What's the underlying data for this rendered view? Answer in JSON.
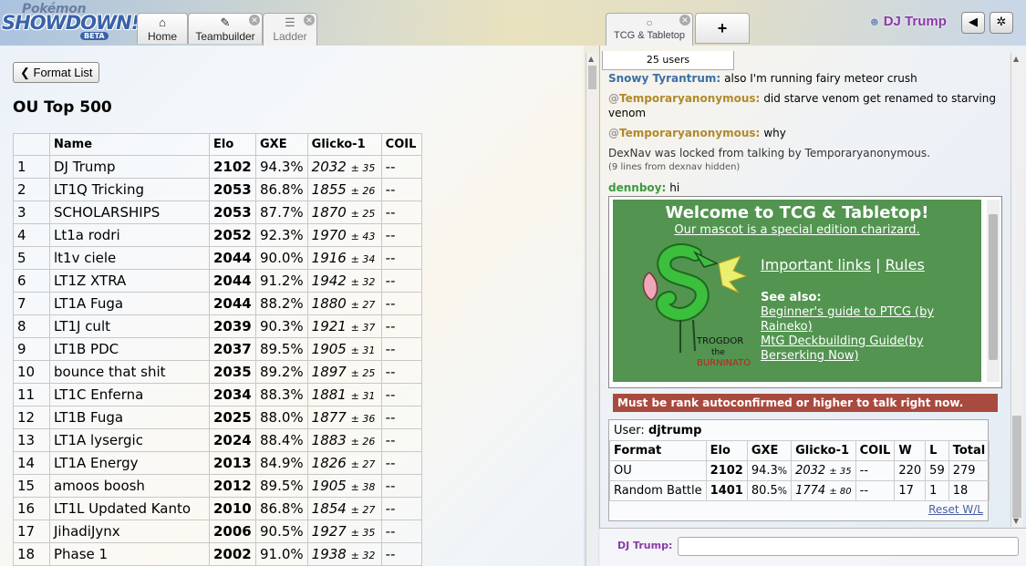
{
  "header": {
    "logo_top": "Pokémon",
    "logo_main": "SHOWDOWN!",
    "logo_beta": "BETA",
    "tabs": [
      {
        "icon": "⌂",
        "label": "Home"
      },
      {
        "icon": "✎",
        "label": "Teambuilder"
      },
      {
        "icon": "☰",
        "label": "Ladder"
      }
    ],
    "close_glyph": "✕",
    "room_tab": {
      "icon": "○",
      "label": "TCG & Tabletop"
    },
    "plus_label": "+",
    "username": "DJ Trump",
    "sound_icon": "◀",
    "settings_icon": "✲"
  },
  "ladder": {
    "back_label": "Format List",
    "title": "OU Top 500",
    "columns": [
      "",
      "Name",
      "Elo",
      "GXE",
      "Glicko-1",
      "COIL"
    ],
    "rows": [
      {
        "rank": "1",
        "name": "DJ Trump",
        "elo": "2102",
        "gxe": "94.3%",
        "glicko": "2032",
        "dev": "± 35",
        "coil": "--"
      },
      {
        "rank": "2",
        "name": "LT1Q Tricking",
        "elo": "2053",
        "gxe": "86.8%",
        "glicko": "1855",
        "dev": "± 26",
        "coil": "--"
      },
      {
        "rank": "3",
        "name": "SCHOLARSHIPS",
        "elo": "2053",
        "gxe": "87.7%",
        "glicko": "1870",
        "dev": "± 25",
        "coil": "--"
      },
      {
        "rank": "4",
        "name": "Lt1a rodri",
        "elo": "2052",
        "gxe": "92.3%",
        "glicko": "1970",
        "dev": "± 43",
        "coil": "--"
      },
      {
        "rank": "5",
        "name": "lt1v ciele",
        "elo": "2044",
        "gxe": "90.0%",
        "glicko": "1916",
        "dev": "± 34",
        "coil": "--"
      },
      {
        "rank": "6",
        "name": "LT1Z XTRA",
        "elo": "2044",
        "gxe": "91.2%",
        "glicko": "1942",
        "dev": "± 32",
        "coil": "--"
      },
      {
        "rank": "7",
        "name": "LT1A Fuga",
        "elo": "2044",
        "gxe": "88.2%",
        "glicko": "1880",
        "dev": "± 27",
        "coil": "--"
      },
      {
        "rank": "8",
        "name": "LT1J cult",
        "elo": "2039",
        "gxe": "90.3%",
        "glicko": "1921",
        "dev": "± 37",
        "coil": "--"
      },
      {
        "rank": "9",
        "name": "LT1B PDC",
        "elo": "2037",
        "gxe": "89.5%",
        "glicko": "1905",
        "dev": "± 31",
        "coil": "--"
      },
      {
        "rank": "10",
        "name": "bounce that shit",
        "elo": "2035",
        "gxe": "89.2%",
        "glicko": "1897",
        "dev": "± 25",
        "coil": "--"
      },
      {
        "rank": "11",
        "name": "LT1C Enferna",
        "elo": "2034",
        "gxe": "88.3%",
        "glicko": "1881",
        "dev": "± 31",
        "coil": "--"
      },
      {
        "rank": "12",
        "name": "LT1B Fuga",
        "elo": "2025",
        "gxe": "88.0%",
        "glicko": "1877",
        "dev": "± 36",
        "coil": "--"
      },
      {
        "rank": "13",
        "name": "LT1A lysergic",
        "elo": "2024",
        "gxe": "88.4%",
        "glicko": "1883",
        "dev": "± 26",
        "coil": "--"
      },
      {
        "rank": "14",
        "name": "LT1A Energy",
        "elo": "2013",
        "gxe": "84.9%",
        "glicko": "1826",
        "dev": "± 27",
        "coil": "--"
      },
      {
        "rank": "15",
        "name": "amoos boosh",
        "elo": "2012",
        "gxe": "89.5%",
        "glicko": "1905",
        "dev": "± 38",
        "coil": "--"
      },
      {
        "rank": "16",
        "name": "LT1L Updated Kanto",
        "elo": "2010",
        "gxe": "86.8%",
        "glicko": "1854",
        "dev": "± 27",
        "coil": "--"
      },
      {
        "rank": "17",
        "name": "JihadiJynx",
        "elo": "2006",
        "gxe": "90.5%",
        "glicko": "1927",
        "dev": "± 35",
        "coil": "--"
      },
      {
        "rank": "18",
        "name": "Phase 1",
        "elo": "2002",
        "gxe": "91.0%",
        "glicko": "1938",
        "dev": "± 32",
        "coil": "--"
      }
    ]
  },
  "chat": {
    "users_count": "25 users",
    "messages": [
      {
        "name": "Snowy Tyrantrum:",
        "prefix": "",
        "text": "also I'm running fairy meteor crush",
        "cls": "snowy"
      },
      {
        "name": "Temporaryanonymous:",
        "prefix": "@",
        "text": "did starve venom get renamed to starving venom",
        "cls": "temp"
      },
      {
        "name": "Temporaryanonymous:",
        "prefix": "@",
        "text": "why",
        "cls": "temp"
      }
    ],
    "system_line": "DexNav was locked from talking by Temporaryanonymous.",
    "system_small": "(9 lines from dexnav hidden)",
    "last": {
      "name": "dennboy:",
      "text": "hi"
    },
    "welcome": {
      "title": "Welcome to TCG & Tabletop!",
      "subtitle": "Our mascot is a special edition charizard.",
      "link1": "Important links",
      "sep": "|",
      "link2": "Rules",
      "see_also": "See also:",
      "items": [
        "Beginner's guide to PTCG (by Raineko)",
        "MtG Deckbuilding Guide(by Berserking Now)"
      ],
      "drawing_text1": "TROGDOR",
      "drawing_text2": "the",
      "drawing_text3": "BURNINATOR"
    },
    "must_rank": "Must be rank autoconfirmed or higher to talk right now.",
    "userbox": {
      "user_label": "User:",
      "user_name": "djtrump",
      "columns": [
        "Format",
        "Elo",
        "GXE",
        "Glicko-1",
        "COIL",
        "W",
        "L",
        "Total"
      ],
      "rows": [
        {
          "format": "OU",
          "elo": "2102",
          "gxe": "94.3",
          "pct": "%",
          "glicko": "2032",
          "dev": "± 35",
          "coil": "--",
          "w": "220",
          "l": "59",
          "total": "279"
        },
        {
          "format": "Random Battle",
          "elo": "1401",
          "gxe": "80.5",
          "pct": "%",
          "glicko": "1774",
          "dev": "± 80",
          "coil": "--",
          "w": "17",
          "l": "1",
          "total": "18"
        }
      ],
      "reset": "Reset W/L"
    },
    "composer_name": "DJ Trump:"
  }
}
